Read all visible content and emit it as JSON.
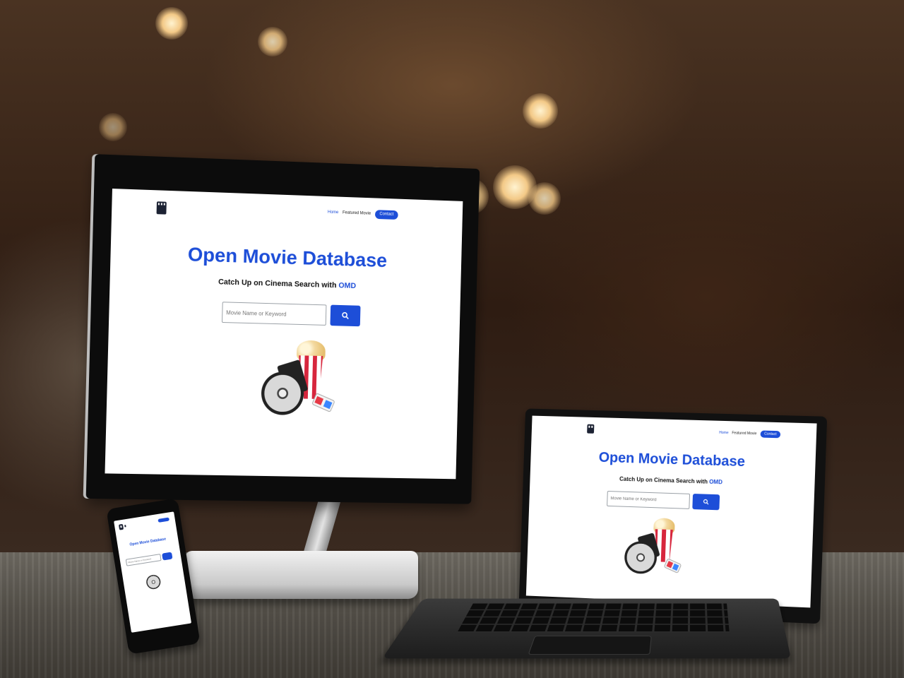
{
  "site": {
    "title": "Open Movie Database",
    "subtitle_prefix": "Catch Up on Cinema Search with ",
    "subtitle_highlight": "OMD",
    "search_placeholder": "Movie Name or Keyword",
    "nav": {
      "home": "Home",
      "featured": "Featured Movie",
      "contact": "Contact"
    }
  },
  "icons": {
    "logo": "clapperboard-logo-icon",
    "search": "search-icon",
    "hero": "movie-reel-popcorn-illustration"
  },
  "colors": {
    "accent": "#1d4ed8",
    "page_bg": "#ffffff",
    "text": "#111111"
  }
}
